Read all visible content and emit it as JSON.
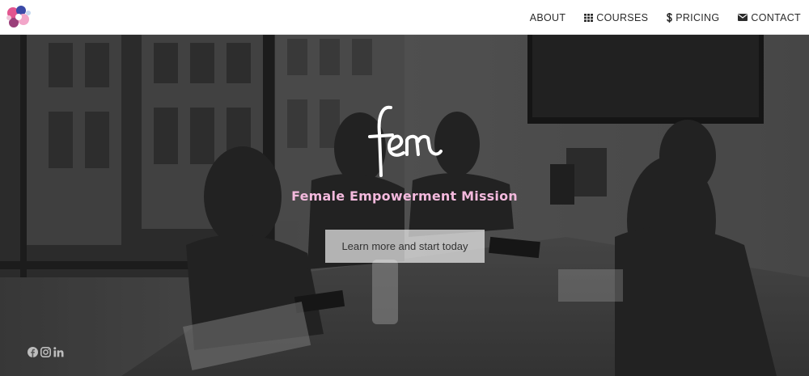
{
  "nav": {
    "items": [
      {
        "label": "ABOUT",
        "icon": ""
      },
      {
        "label": "COURSES",
        "icon": "grid-icon"
      },
      {
        "label": "PRICING",
        "icon": "dollar-icon"
      },
      {
        "label": "CONTACT",
        "icon": "envelope-icon"
      }
    ]
  },
  "hero": {
    "tagline": "Female Empowerment Mission",
    "cta_label": "Learn more and start today"
  },
  "social": {
    "icons": [
      "facebook-icon",
      "instagram-icon",
      "linkedin-icon"
    ]
  },
  "colors": {
    "tagline": "#f3b9dd",
    "nav_text": "#2b2b2b",
    "button_bg": "#ebebeb"
  }
}
